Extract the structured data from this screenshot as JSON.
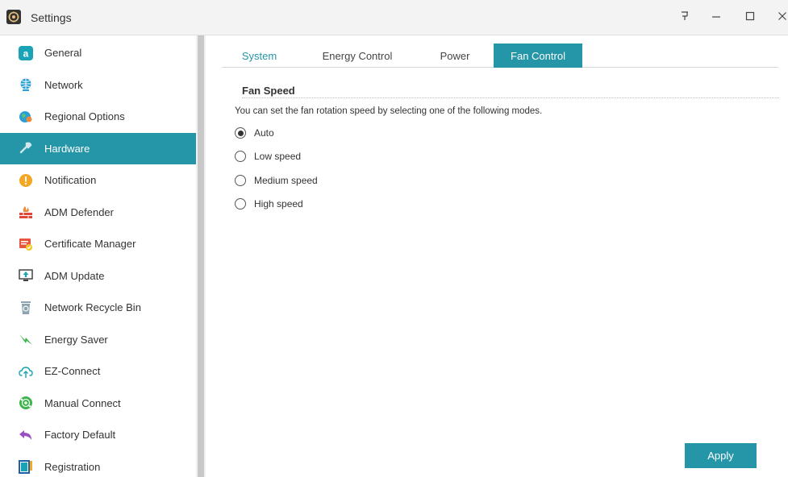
{
  "window": {
    "title": "Settings",
    "app_icon": "settings-app-icon",
    "controls": [
      "pin-icon",
      "minimize-icon",
      "maximize-icon",
      "close-icon"
    ]
  },
  "sidebar": {
    "items": [
      {
        "label": "General",
        "icon": "general-icon"
      },
      {
        "label": "Network",
        "icon": "globe-icon"
      },
      {
        "label": "Regional Options",
        "icon": "regional-icon"
      },
      {
        "label": "Hardware",
        "icon": "hardware-icon",
        "active": true
      },
      {
        "label": "Notification",
        "icon": "exclamation-icon"
      },
      {
        "label": "ADM Defender",
        "icon": "firewall-icon"
      },
      {
        "label": "Certificate Manager",
        "icon": "certificate-icon"
      },
      {
        "label": "ADM Update",
        "icon": "update-icon"
      },
      {
        "label": "Network Recycle Bin",
        "icon": "recycle-bin-icon"
      },
      {
        "label": "Energy Saver",
        "icon": "energy-icon"
      },
      {
        "label": "EZ-Connect",
        "icon": "cloud-upload-icon"
      },
      {
        "label": "Manual Connect",
        "icon": "manual-connect-icon"
      },
      {
        "label": "Factory Default",
        "icon": "undo-arrow-icon"
      },
      {
        "label": "Registration",
        "icon": "registration-icon"
      }
    ]
  },
  "tabs": [
    {
      "label": "System"
    },
    {
      "label": "Energy Control"
    },
    {
      "label": "Power"
    },
    {
      "label": "Fan Control",
      "active": true
    }
  ],
  "fan": {
    "section_title": "Fan Speed",
    "description": "You can set the fan rotation speed by selecting one of the following modes.",
    "options": [
      {
        "label": "Auto",
        "selected": true
      },
      {
        "label": "Low speed",
        "selected": false
      },
      {
        "label": "Medium speed",
        "selected": false
      },
      {
        "label": "High speed",
        "selected": false
      }
    ]
  },
  "apply_label": "Apply",
  "colors": {
    "accent": "#2596a8",
    "titlebar": "#f3f3f3",
    "scrollbar_thumb": "#c8c8c8"
  }
}
